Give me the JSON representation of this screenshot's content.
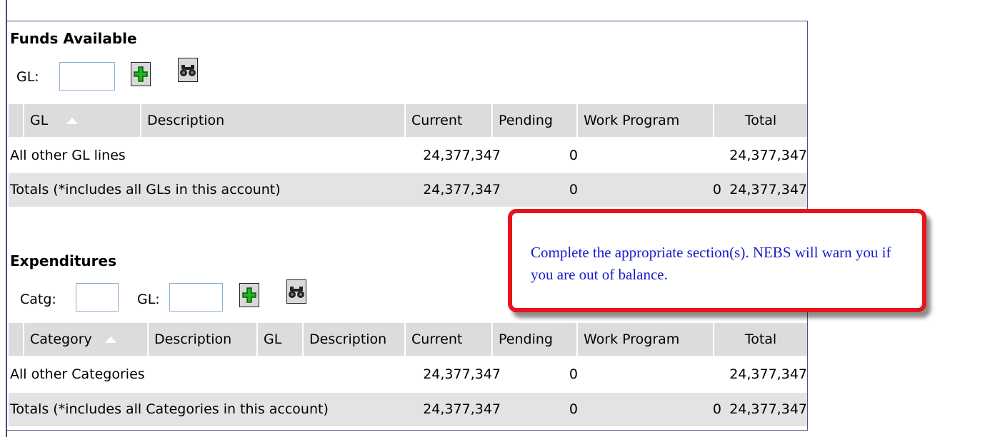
{
  "funds_available": {
    "title": "Funds Available",
    "gl_label": "GL:",
    "gl_value": "",
    "add_icon": "plus-icon",
    "search_icon": "binoculars-icon",
    "columns": [
      "GL",
      "Description",
      "Current",
      "Pending",
      "Work Program",
      "Total"
    ],
    "sorted_column": "GL",
    "rows": [
      {
        "label": "All other GL lines",
        "current": "24,377,347",
        "pending": "0",
        "work_program": "",
        "total": "24,377,347"
      },
      {
        "label": "Totals (*includes all GLs in this account)",
        "current": "24,377,347",
        "pending": "0",
        "work_program": "0",
        "total": "24,377,347"
      }
    ]
  },
  "expenditures": {
    "title": "Expenditures",
    "catg_label": "Catg:",
    "catg_value": "",
    "gl_label": "GL:",
    "gl_value": "",
    "add_icon": "plus-icon",
    "search_icon": "binoculars-icon",
    "columns": [
      "Category",
      "Description",
      "GL",
      "Description",
      "Current",
      "Pending",
      "Work Program",
      "Total"
    ],
    "sorted_column": "Category",
    "rows": [
      {
        "label": "All other Categories",
        "current": "24,377,347",
        "pending": "0",
        "work_program": "",
        "total": "24,377,347"
      },
      {
        "label": "Totals (*includes all Categories in this account)",
        "current": "24,377,347",
        "pending": "0",
        "work_program": "0",
        "total": "24,377,347"
      }
    ]
  },
  "callout": {
    "text": "Complete the appropriate section(s). NEBS will warn you if you are out of balance.",
    "border_color": "#e8141c",
    "text_color": "#1a1acc"
  },
  "colors": {
    "header_bg": "#dcdcdc",
    "alt_row_bg": "#e3e3e3",
    "input_border": "#8aaed6",
    "plus_green": "#1fb51f"
  }
}
